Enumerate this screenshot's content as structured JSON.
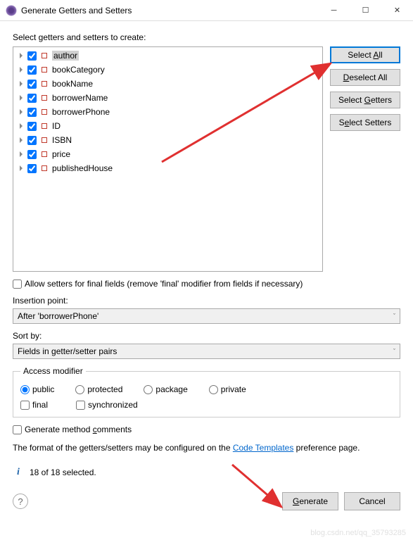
{
  "titlebar": {
    "title": "Generate Getters and Setters"
  },
  "instruction": "Select getters and setters to create:",
  "fields": [
    {
      "name": "author",
      "selected": true
    },
    {
      "name": "bookCategory",
      "selected": false
    },
    {
      "name": "bookName",
      "selected": false
    },
    {
      "name": "borrowerName",
      "selected": false
    },
    {
      "name": "borrowerPhone",
      "selected": false
    },
    {
      "name": "ID",
      "selected": false
    },
    {
      "name": "ISBN",
      "selected": false
    },
    {
      "name": "price",
      "selected": false
    },
    {
      "name": "publishedHouse",
      "selected": false
    }
  ],
  "sideButtons": {
    "selectAll": {
      "pre": "Select ",
      "u": "A",
      "post": "ll"
    },
    "deselectAll": {
      "pre": "",
      "u": "D",
      "post": "eselect All"
    },
    "selectGetters": {
      "pre": "Select ",
      "u": "G",
      "post": "etters"
    },
    "selectSetters": {
      "pre": "S",
      "u": "e",
      "post": "lect Setters"
    }
  },
  "allowFinal": {
    "label": "Allow setters for final fields (remove 'final' modifier from fields if necessary)",
    "checked": false
  },
  "insertionPoint": {
    "label": "Insertion point:",
    "value": "After 'borrowerPhone'"
  },
  "sortBy": {
    "label": "Sort by:",
    "value": "Fields in getter/setter pairs"
  },
  "accessModifier": {
    "legend": "Access modifier",
    "options": [
      {
        "label": "public",
        "checked": true,
        "blue": false
      },
      {
        "label": "protected",
        "checked": false,
        "blue": false
      },
      {
        "label": "package",
        "checked": false,
        "blue": true
      },
      {
        "label": "private",
        "checked": false,
        "blue": false
      }
    ],
    "final": {
      "label": "final",
      "checked": false
    },
    "synchronized": {
      "label": "synchronized",
      "checked": false
    }
  },
  "generateComments": {
    "pre": "Generate method ",
    "u": "c",
    "post": "omments",
    "checked": false
  },
  "formatText": {
    "pre": "The format of the getters/setters may be configured on the ",
    "link": "Code Templates",
    "post": " preference page."
  },
  "status": "18 of 18 selected.",
  "actions": {
    "generate": {
      "pre": "",
      "u": "G",
      "post": "enerate"
    },
    "cancel": "Cancel"
  },
  "watermark": "blog.csdn.net/qq_35793285"
}
